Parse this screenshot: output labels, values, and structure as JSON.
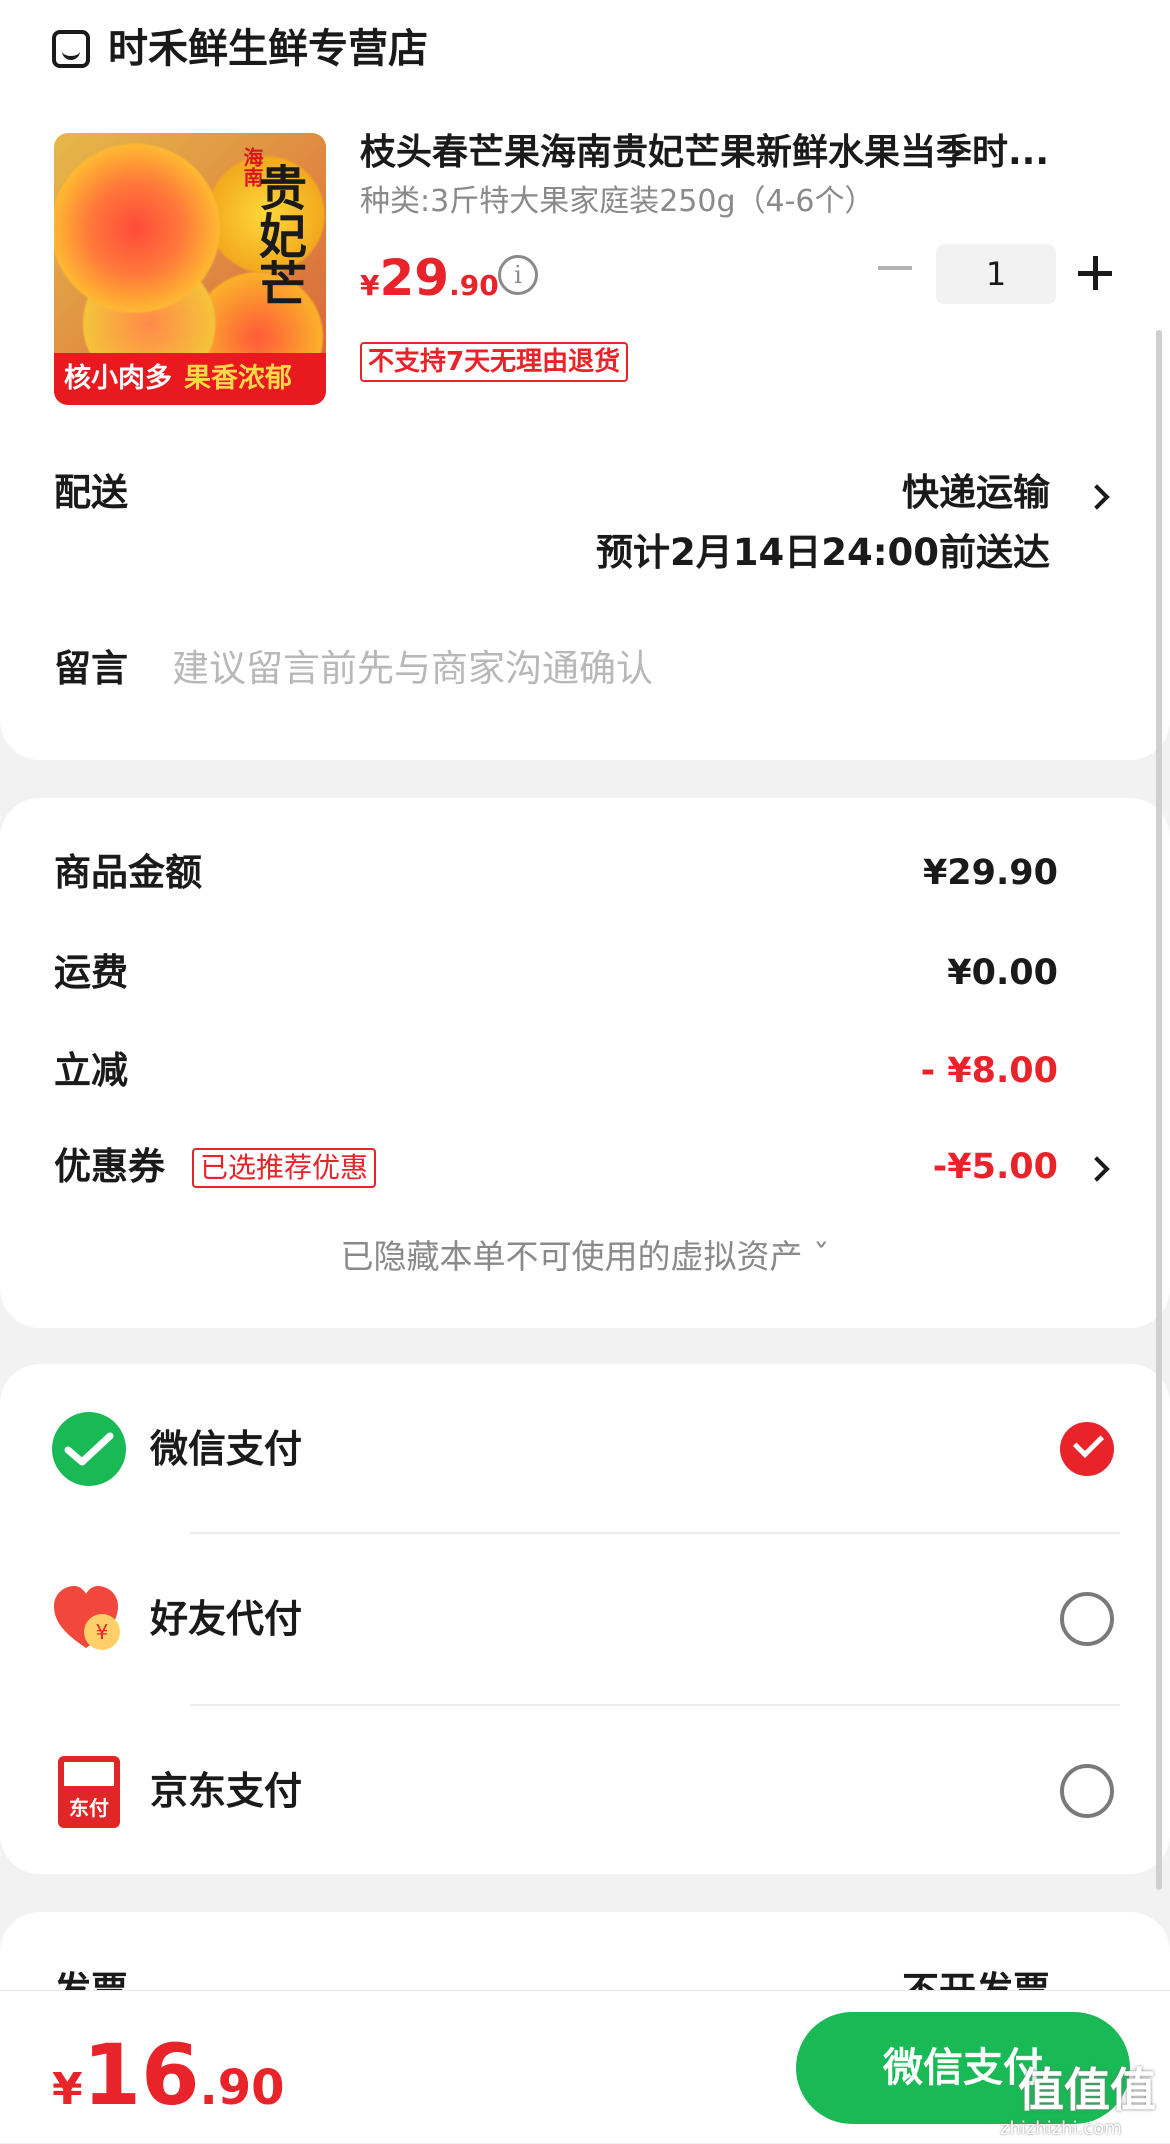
{
  "shop": {
    "name": "时禾鲜生鲜专营店",
    "icon": "shop-icon"
  },
  "product": {
    "image_badge_vertical": "贵妃芒",
    "image_badge_small": "海南",
    "image_bottom_left": "核小肉多",
    "image_bottom_right": "果香浓郁",
    "title": "枝头春芒果海南贵妃芒果新鲜水果当季时...",
    "sku": "种类:3斤特大果家庭装250g（4-6个）",
    "price_currency": "¥",
    "price_integer": "29",
    "price_decimal": ".90",
    "info_icon_glyph": "i",
    "quantity": "1",
    "return_policy": "不支持7天无理由退货"
  },
  "delivery": {
    "label": "配送",
    "method": "快递运输",
    "eta": "预计2月14日24:00前送达"
  },
  "message": {
    "label": "留言",
    "placeholder": "建议留言前先与商家沟通确认"
  },
  "summary": {
    "goods_label": "商品金额",
    "goods_value": "¥29.90",
    "shipping_label": "运费",
    "shipping_value": "¥0.00",
    "discount_label": "立减",
    "discount_value": "- ¥8.00",
    "coupon_label": "优惠券",
    "coupon_tag": "已选推荐优惠",
    "coupon_value": "-¥5.00",
    "hidden_assets": "已隐藏本单不可使用的虚拟资产 ˇ"
  },
  "payment": {
    "options": [
      {
        "label": "微信支付",
        "icon": "wechat-pay-icon",
        "selected": true
      },
      {
        "label": "好友代付",
        "icon": "friend-pay-icon",
        "selected": false
      },
      {
        "label": "京东支付",
        "icon": "jd-pay-icon",
        "icon_text": "东付",
        "selected": false
      }
    ]
  },
  "invoice": {
    "label": "发票",
    "value": "不开发票"
  },
  "footer": {
    "total_currency": "¥",
    "total_integer": "16",
    "total_decimal": ".90",
    "pay_button": "微信支付"
  },
  "watermark": {
    "text": "值值值",
    "sub": "zhizhizhi.com"
  },
  "colors": {
    "accent_red": "#e8232a",
    "wechat_green": "#19b955"
  }
}
